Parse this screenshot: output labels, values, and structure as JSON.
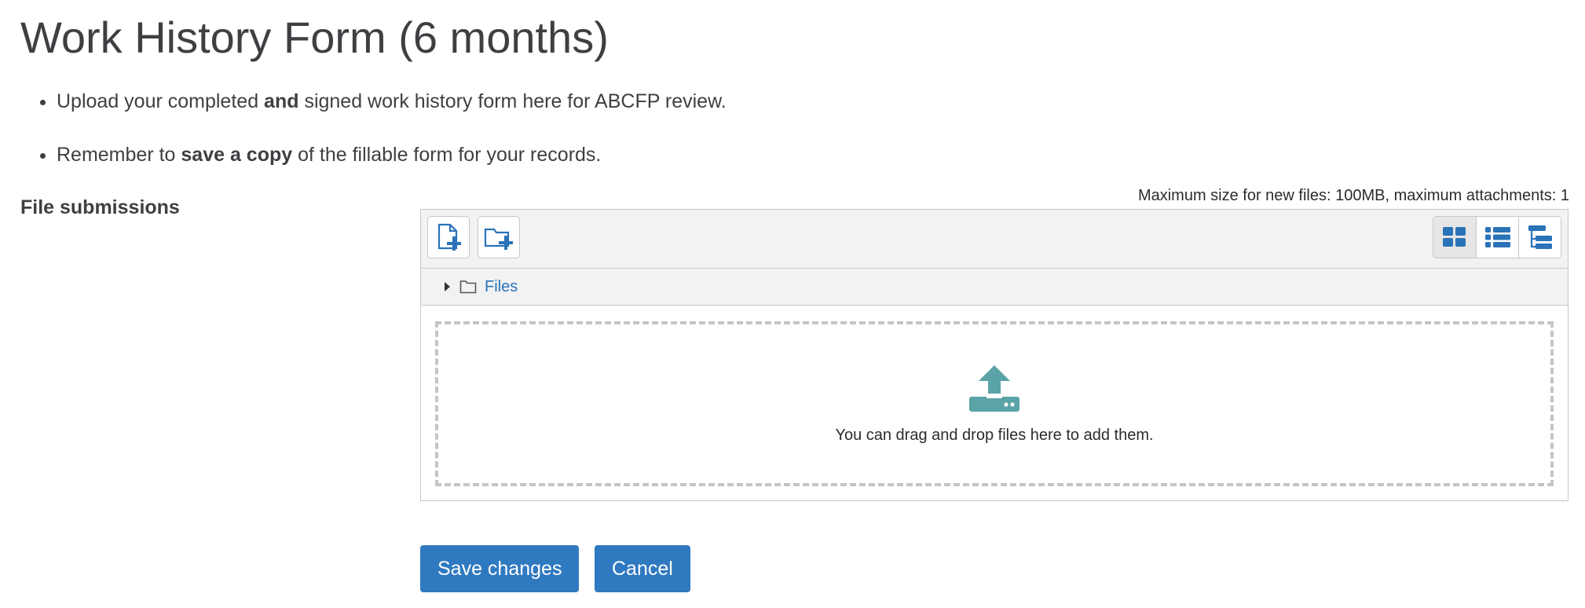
{
  "title": "Work History Form (6 months)",
  "bullets": [
    {
      "before": "Upload your completed ",
      "bold": "and",
      "after": " signed work history form here for ABCFP review."
    },
    {
      "before": "Remember to ",
      "bold": "save a copy",
      "after": " of the fillable form for your records."
    }
  ],
  "file_submissions": {
    "label": "File submissions",
    "max_info": "Maximum size for new files: 100MB, maximum attachments: 1",
    "toolbar": {
      "add_file_icon": "file-add-icon",
      "add_folder_icon": "folder-add-icon",
      "views": [
        "grid-view-icon",
        "list-view-icon",
        "tree-view-icon"
      ]
    },
    "path_label": "Files",
    "drop_text": "You can drag and drop files here to add them.",
    "upload_icon": "upload-icon"
  },
  "buttons": {
    "save": "Save changes",
    "cancel": "Cancel"
  },
  "colors": {
    "accent": "#2f79c0",
    "icon_blue": "#2a73b8",
    "upload_teal": "#5aa3a6"
  }
}
